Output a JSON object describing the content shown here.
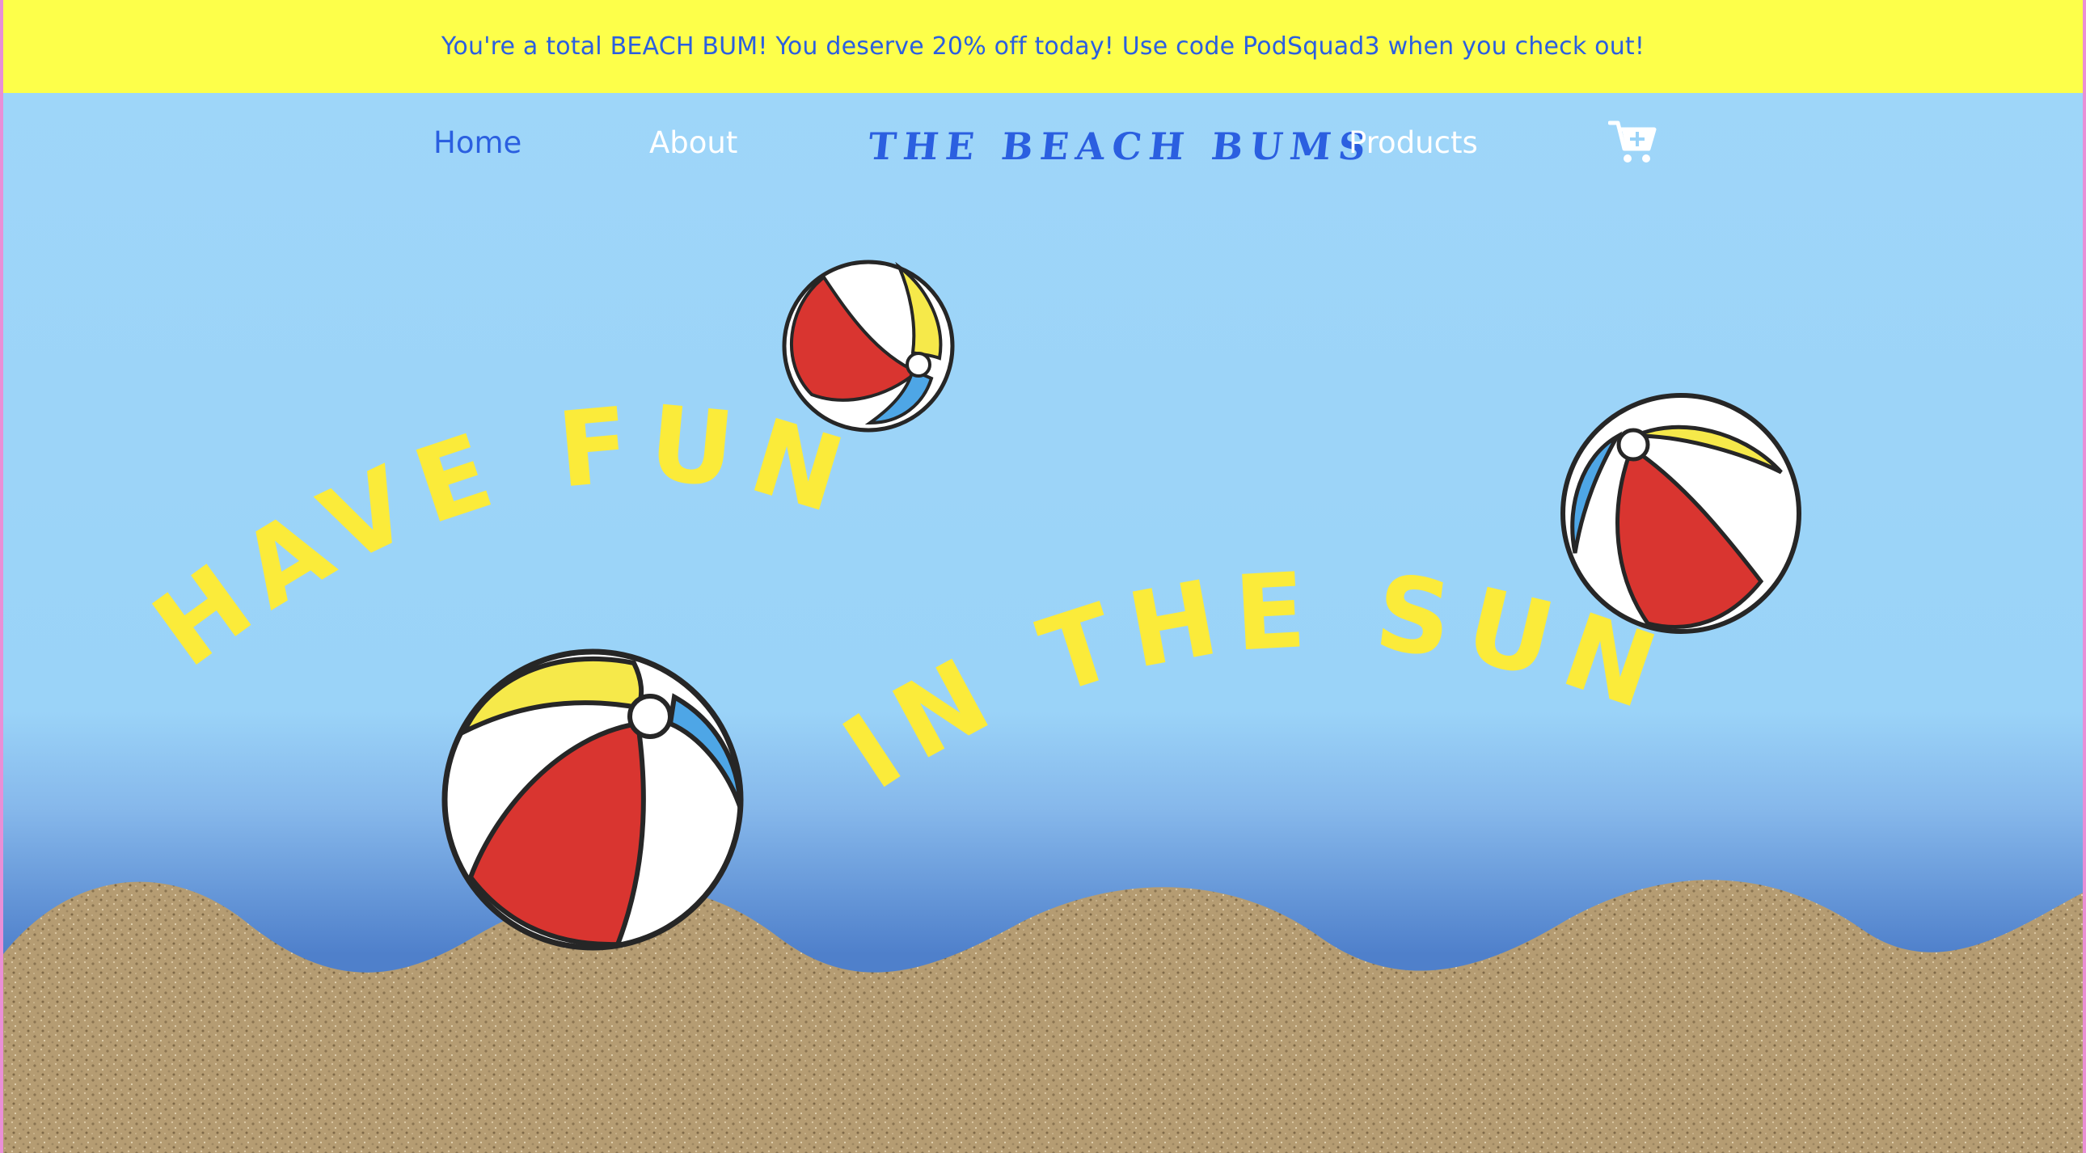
{
  "promo": {
    "text": "You're a total BEACH BUM! You deserve 20% off today! Use code PodSquad3 when you check out!"
  },
  "nav": {
    "home": "Home",
    "about": "About",
    "brand": "THE BEACH BUMS",
    "products": "Products",
    "cart_icon": "cart-plus-icon"
  },
  "hero": {
    "line1": "HAVE FUN",
    "line2": "IN THE SUN"
  },
  "colors": {
    "promo_bg": "#fdff4a",
    "accent_blue": "#2b5fe0",
    "sky": "#9ad3f8",
    "headline_yellow": "#fbeb3a",
    "ball_red": "#d93530",
    "ball_yellow": "#f6e94a",
    "ball_blue": "#4ea6e6"
  },
  "icons": [
    "cart-plus-icon",
    "beach-ball-icon"
  ]
}
